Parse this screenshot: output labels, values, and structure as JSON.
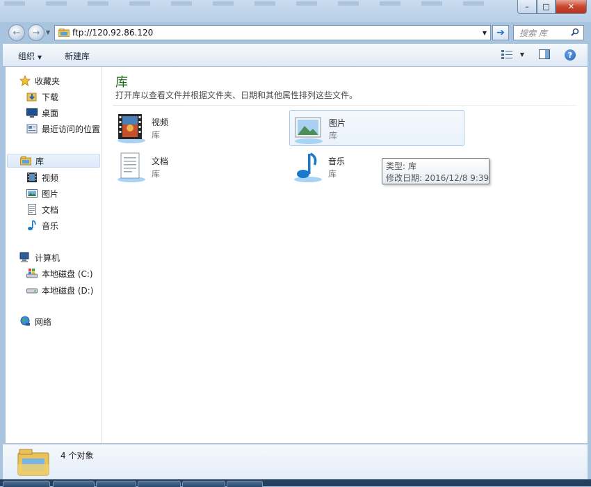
{
  "window": {
    "controls": {
      "minimize": "–",
      "maximize": "□",
      "close": "✕"
    }
  },
  "navigation": {
    "back_glyph": "←",
    "forward_glyph": "→",
    "address": "ftp://120.92.86.120",
    "go_glyph": "➔",
    "search_placeholder": "搜索 库"
  },
  "toolbar": {
    "organize": "组织",
    "new_library": "新建库",
    "help_glyph": "?"
  },
  "sidebar": {
    "favorites": {
      "label": "收藏夹",
      "items": [
        "下载",
        "桌面",
        "最近访问的位置"
      ]
    },
    "libraries": {
      "label": "库",
      "items": [
        "视频",
        "图片",
        "文档",
        "音乐"
      ]
    },
    "computer": {
      "label": "计算机",
      "items": [
        "本地磁盘 (C:)",
        "本地磁盘 (D:)"
      ]
    },
    "network": {
      "label": "网络"
    }
  },
  "main": {
    "title": "库",
    "description": "打开库以查看文件并根据文件夹、日期和其他属性排列这些文件。",
    "libraries": [
      {
        "name": "视频",
        "type": "库",
        "icon": "video-library-icon"
      },
      {
        "name": "图片",
        "type": "库",
        "icon": "pictures-library-icon"
      },
      {
        "name": "文档",
        "type": "库",
        "icon": "documents-library-icon"
      },
      {
        "name": "音乐",
        "type": "库",
        "icon": "music-library-icon"
      }
    ]
  },
  "tooltip": {
    "type_line": "类型: 库",
    "modified_line": "修改日期: 2016/12/8 9:39"
  },
  "status": {
    "count": "4 个对象"
  },
  "colors": {
    "accent_title": "#1e6b1e",
    "selection": "#dbe9f9",
    "frame": "#a8c4df"
  }
}
